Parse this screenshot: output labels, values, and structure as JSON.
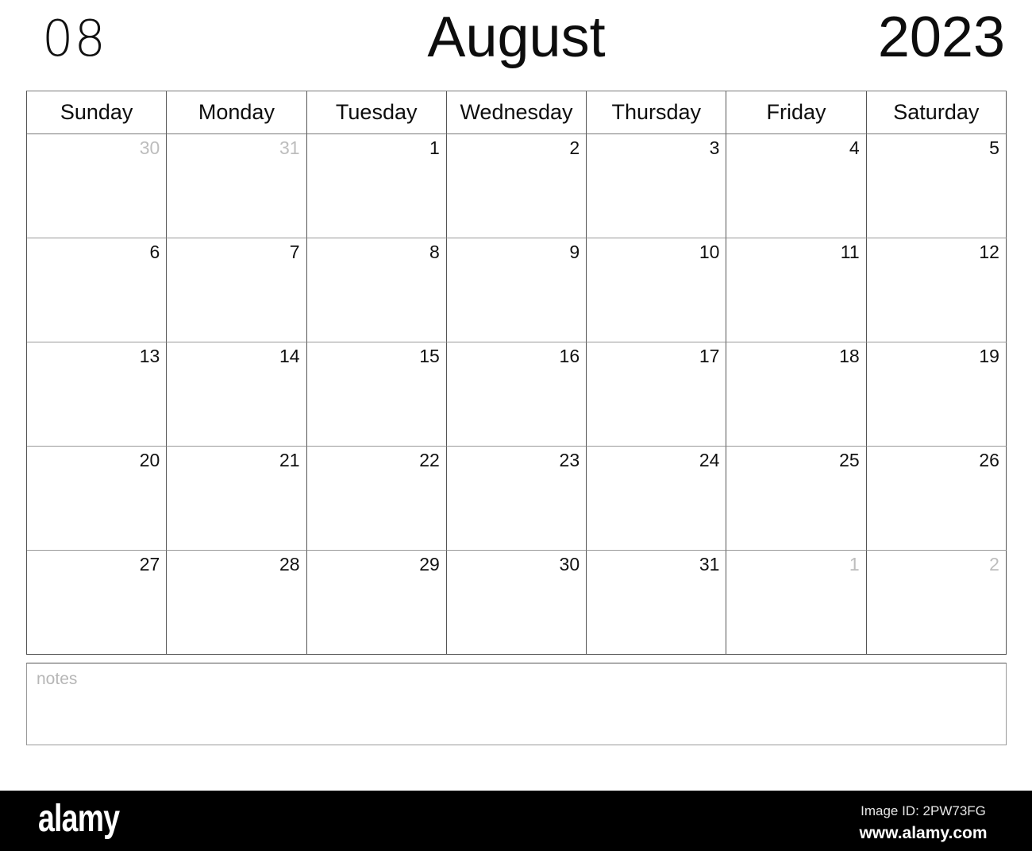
{
  "header": {
    "month_number": "08",
    "month_name": "August",
    "year": "2023"
  },
  "grid": {
    "day_names": [
      "Sunday",
      "Monday",
      "Tuesday",
      "Wednesday",
      "Thursday",
      "Friday",
      "Saturday"
    ],
    "weeks": [
      [
        {
          "n": "30",
          "muted": true
        },
        {
          "n": "31",
          "muted": true
        },
        {
          "n": "1",
          "muted": false
        },
        {
          "n": "2",
          "muted": false
        },
        {
          "n": "3",
          "muted": false
        },
        {
          "n": "4",
          "muted": false
        },
        {
          "n": "5",
          "muted": false
        }
      ],
      [
        {
          "n": "6",
          "muted": false
        },
        {
          "n": "7",
          "muted": false
        },
        {
          "n": "8",
          "muted": false
        },
        {
          "n": "9",
          "muted": false
        },
        {
          "n": "10",
          "muted": false
        },
        {
          "n": "11",
          "muted": false
        },
        {
          "n": "12",
          "muted": false
        }
      ],
      [
        {
          "n": "13",
          "muted": false
        },
        {
          "n": "14",
          "muted": false
        },
        {
          "n": "15",
          "muted": false
        },
        {
          "n": "16",
          "muted": false
        },
        {
          "n": "17",
          "muted": false
        },
        {
          "n": "18",
          "muted": false
        },
        {
          "n": "19",
          "muted": false
        }
      ],
      [
        {
          "n": "20",
          "muted": false
        },
        {
          "n": "21",
          "muted": false
        },
        {
          "n": "22",
          "muted": false
        },
        {
          "n": "23",
          "muted": false
        },
        {
          "n": "24",
          "muted": false
        },
        {
          "n": "25",
          "muted": false
        },
        {
          "n": "26",
          "muted": false
        }
      ],
      [
        {
          "n": "27",
          "muted": false
        },
        {
          "n": "28",
          "muted": false
        },
        {
          "n": "29",
          "muted": false
        },
        {
          "n": "30",
          "muted": false
        },
        {
          "n": "31",
          "muted": false
        },
        {
          "n": "1",
          "muted": true
        },
        {
          "n": "2",
          "muted": true
        }
      ]
    ]
  },
  "notes": {
    "placeholder": "notes"
  },
  "watermark": {
    "logo": "alamy",
    "image_id": "Image ID: 2PW73FG",
    "url": "www.alamy.com"
  },
  "colors": {
    "text": "#0d0d0d",
    "muted": "#bdbdbd",
    "grid_line": "#555555",
    "grid_line_light": "#9a9a9a",
    "watermark_bg": "#000000"
  }
}
